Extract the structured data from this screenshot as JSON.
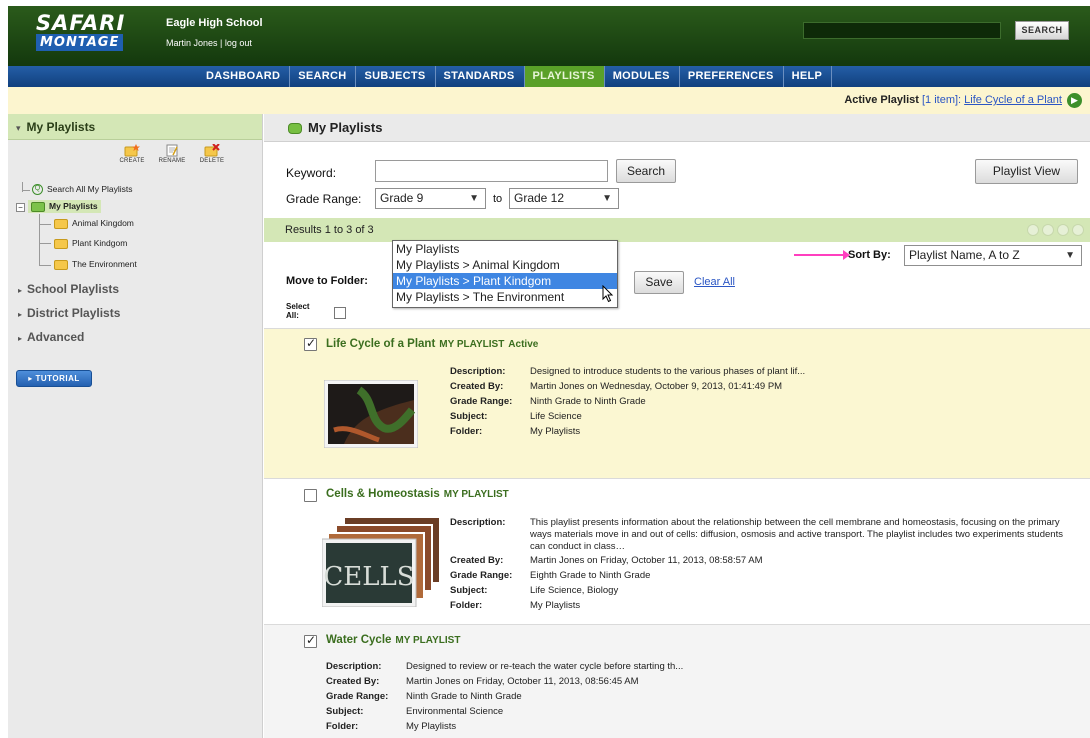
{
  "header": {
    "logo_top": "SAFARI",
    "logo_bottom": "MONTAGE",
    "school": "Eagle High School",
    "user": "Martin Jones",
    "logout": "log out",
    "search_button": "SEARCH"
  },
  "nav": [
    "DASHBOARD",
    "SEARCH",
    "SUBJECTS",
    "STANDARDS",
    "PLAYLISTS",
    "MODULES",
    "PREFERENCES",
    "HELP"
  ],
  "active_nav": "PLAYLISTS",
  "active_playlist": {
    "label": "Active Playlist",
    "count": "[1 item]:",
    "name": "Life Cycle of a Plant"
  },
  "sidebar": {
    "title": "My Playlists",
    "tools": [
      "CREATE",
      "RENAME",
      "DELETE"
    ],
    "tree": {
      "search_all": "Search All My Playlists",
      "root": "My Playlists",
      "children": [
        "Animal Kingdom",
        "Plant Kindgom",
        "The Environment"
      ]
    },
    "sections": [
      "School Playlists",
      "District Playlists",
      "Advanced"
    ],
    "tutorial": "TUTORIAL"
  },
  "main": {
    "title": "My Playlists",
    "keyword_label": "Keyword:",
    "keyword_value": "",
    "search_button": "Search",
    "playlist_view_button": "Playlist View",
    "grade_range_label": "Grade Range:",
    "grade_from": "Grade 9",
    "to_label": "to",
    "grade_to": "Grade 12",
    "results": "Results 1 to 3 of 3",
    "sort_label": "Sort By:",
    "sort_value": "Playlist Name, A to Z",
    "move_label": "Move to Folder:",
    "folder_options": [
      "My Playlists",
      "My Playlists > Animal Kingdom",
      "My Playlists > Plant Kindgom",
      "My Playlists > The Environment"
    ],
    "highlighted_option": "My Playlists > Plant Kindgom",
    "save_button": "Save",
    "clear_all": "Clear All",
    "select_all_label_1": "Select",
    "select_all_label_2": "All:"
  },
  "meta_labels": {
    "description": "Description:",
    "created_by": "Created By:",
    "grade_range": "Grade Range:",
    "subject": "Subject:",
    "folder": "Folder:"
  },
  "playlists": [
    {
      "title": "Life Cycle of a Plant",
      "tag": "MY PLAYLIST",
      "status": "Active",
      "checked": true,
      "description": "Designed to introduce students to the various phases of plant lif...",
      "created_by": "Martin Jones on Wednesday, October 9, 2013, 01:41:49 PM",
      "grade_range": "Ninth Grade to Ninth Grade",
      "subject": "Life Science",
      "folder": "My Playlists"
    },
    {
      "title": "Cells & Homeostasis",
      "tag": "MY PLAYLIST",
      "status": "",
      "checked": false,
      "thumb_text": "CELLS",
      "description": "This playlist presents information about the relationship between the cell membrane and homeostasis, focusing on the primary ways materials move in and out of cells: diffusion, osmosis and active transport. The playlist includes two experiments students can conduct in class…",
      "created_by": "Martin Jones on Friday, October 11, 2013, 08:58:57 AM",
      "grade_range": "Eighth Grade to Ninth Grade",
      "subject": "Life Science, Biology",
      "folder": "My Playlists"
    },
    {
      "title": "Water Cycle",
      "tag": "MY PLAYLIST",
      "status": "",
      "checked": true,
      "description": "Designed to review or re-teach the water cycle before starting th...",
      "created_by": "Martin Jones on Friday, October 11, 2013, 08:56:45 AM",
      "grade_range": "Ninth Grade to Ninth Grade",
      "subject": "Environmental Science",
      "folder": "My Playlists"
    }
  ],
  "colors": {
    "header_green": "#1f4a14",
    "nav_blue": "#1a4f94",
    "active_tab": "#5aa028",
    "active_row": "#fbf7d2",
    "highlight": "#3f86e2",
    "arrow": "#ff3fbf"
  }
}
